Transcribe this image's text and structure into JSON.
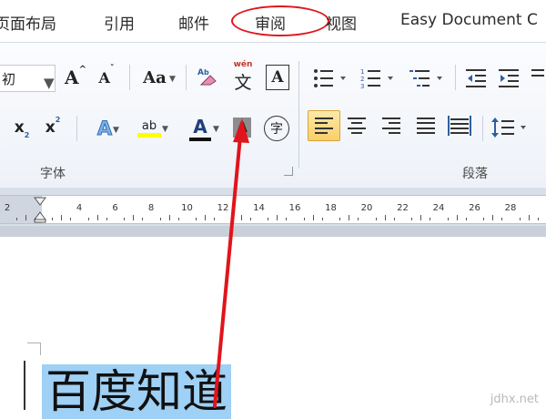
{
  "menu_tabs": [
    {
      "label": "页面布局"
    },
    {
      "label": "引用"
    },
    {
      "label": "邮件"
    },
    {
      "label": "审阅"
    },
    {
      "label": "视图"
    },
    {
      "label": "Easy Document C"
    }
  ],
  "annotation_color": "#e0141c",
  "ribbon": {
    "font_size_value": "初",
    "grow_font": "A",
    "shrink_font": "A",
    "change_case": "Aa",
    "phonetic_guide": "wén",
    "phonetic_char": "文",
    "char_border": "A",
    "subscript": "x",
    "subscript_mark": "2",
    "superscript": "x",
    "superscript_mark": "2",
    "text_effect": "A",
    "highlight": "ab",
    "font_color": "A",
    "char_shading": "A",
    "enclose_char": "字",
    "font_group_label": "字体",
    "paragraph_group_label": "段落"
  },
  "ruler": {
    "labels": [
      "2",
      "2",
      "4",
      "6",
      "8",
      "10",
      "12",
      "14",
      "16",
      "18",
      "20",
      "22",
      "24",
      "26",
      "28"
    ]
  },
  "document": {
    "selected_text": "百度知道",
    "selection_color": "#9fd0f5"
  },
  "watermark": "jdhx.net"
}
